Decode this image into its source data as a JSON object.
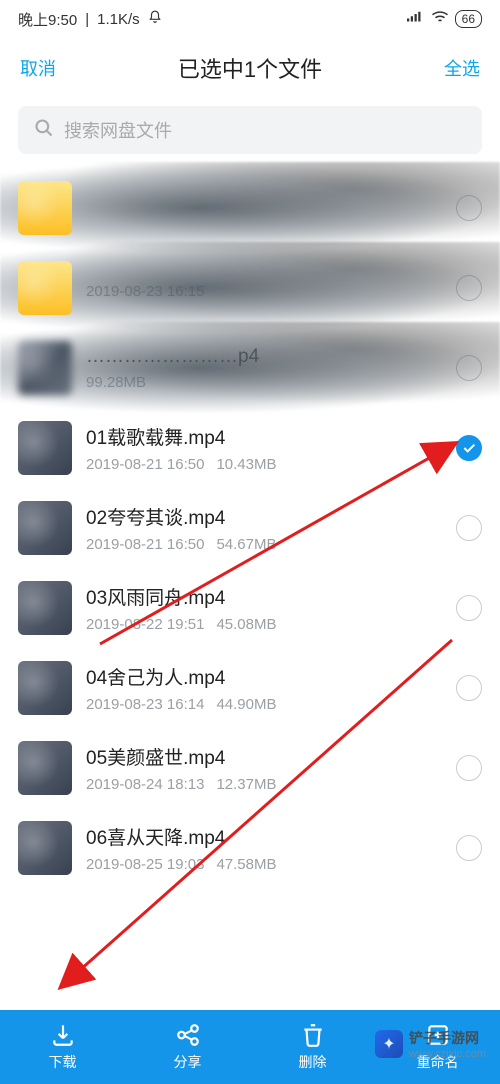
{
  "status": {
    "time": "晚上9:50",
    "net": "1.1K/s",
    "battery": "66"
  },
  "header": {
    "cancel": "取消",
    "title": "已选中1个文件",
    "select_all": "全选"
  },
  "search": {
    "placeholder": "搜索网盘文件"
  },
  "files": [
    {
      "name": "",
      "date": "",
      "size": "",
      "selected": false,
      "obscured": true,
      "thumb": "folder"
    },
    {
      "name": "",
      "date": "2019-08-23  16:15",
      "size": "",
      "selected": false,
      "obscured": true,
      "thumb": "folder"
    },
    {
      "name": "……………………p4",
      "date": "",
      "size": "99.28MB",
      "selected": false,
      "obscured": true,
      "thumb": "blur"
    },
    {
      "name": "01载歌载舞.mp4",
      "date": "2019-08-21  16:50",
      "size": "10.43MB",
      "selected": true,
      "thumb": "video"
    },
    {
      "name": "02夸夸其谈.mp4",
      "date": "2019-08-21  16:50",
      "size": "54.67MB",
      "selected": false,
      "thumb": "video"
    },
    {
      "name": "03风雨同舟.mp4",
      "date": "2019-08-22  19:51",
      "size": "45.08MB",
      "selected": false,
      "thumb": "video"
    },
    {
      "name": "04舍己为人.mp4",
      "date": "2019-08-23  16:14",
      "size": "44.90MB",
      "selected": false,
      "thumb": "video"
    },
    {
      "name": "05美颜盛世.mp4",
      "date": "2019-08-24  18:13",
      "size": "12.37MB",
      "selected": false,
      "thumb": "video"
    },
    {
      "name": "06喜从天降.mp4",
      "date": "2019-08-25  19:03",
      "size": "47.58MB",
      "selected": false,
      "thumb": "video"
    }
  ],
  "bottom": {
    "download": "下载",
    "share": "分享",
    "delete": "删除",
    "rename": "重命名"
  },
  "watermark": "铲子手游网",
  "watermark_url": "www.czjxjc.com"
}
